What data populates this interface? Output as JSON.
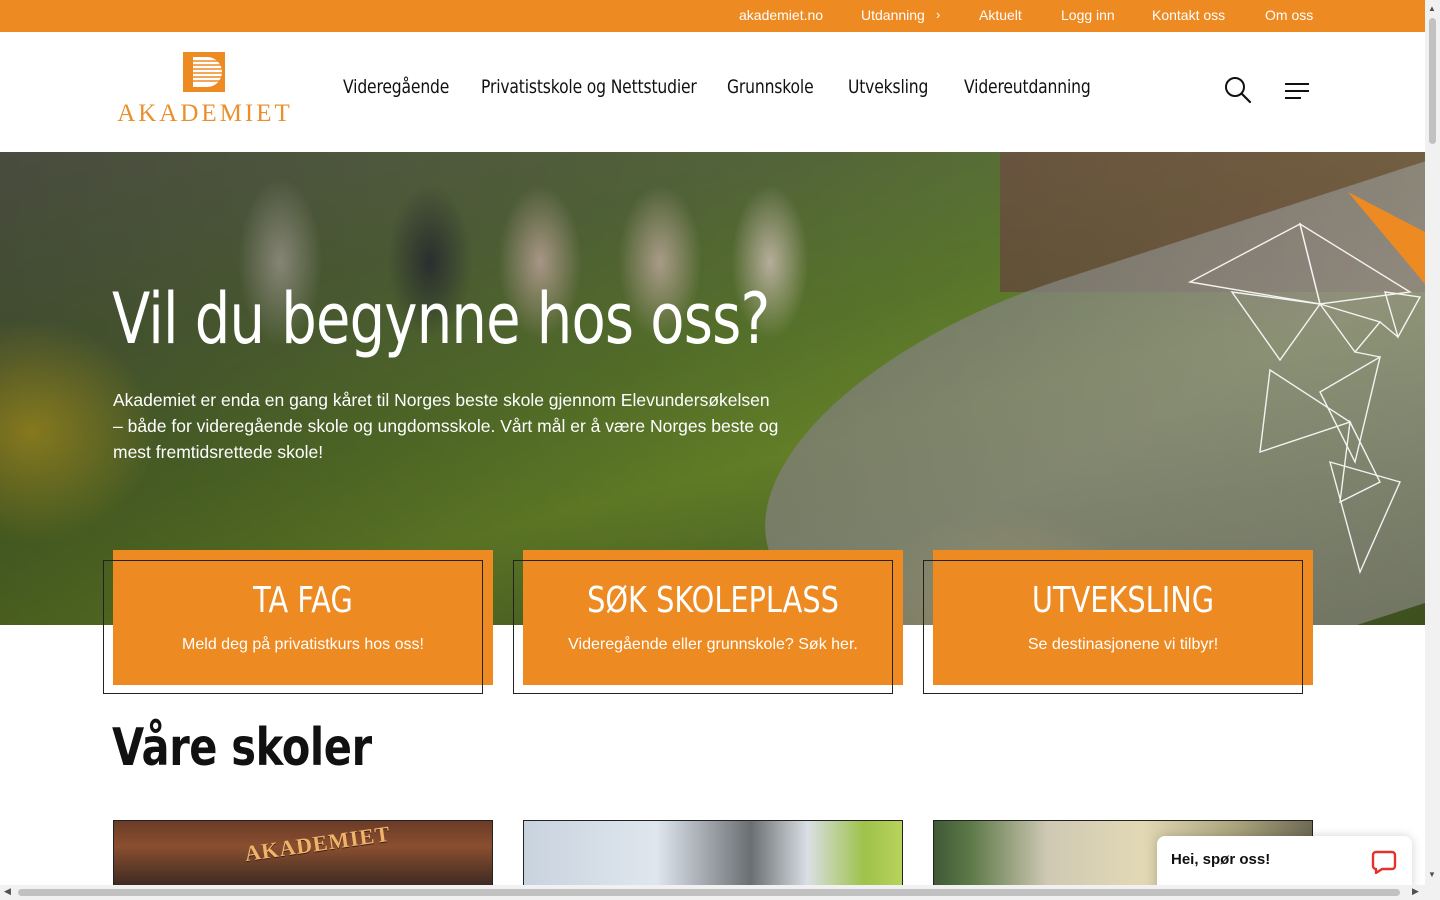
{
  "topbar": {
    "links": [
      "akademiet.no",
      "Utdanning",
      "Aktuelt",
      "Logg inn",
      "Kontakt oss",
      "Om oss"
    ]
  },
  "header": {
    "logo_text": "AKADEMIET",
    "nav": [
      "Videregående",
      "Privatistskole og Nettstudier",
      "Grunnskole",
      "Utveksling",
      "Videreutdanning"
    ],
    "search_icon": "search-icon",
    "menu_icon": "menu-icon"
  },
  "hero": {
    "title": "Vil du begynne hos oss?",
    "text": "Akademiet er enda en gang kåret til Norges beste skole gjennom Elevundersøkelsen – både for videregående skole og ungdomsskole. Vårt mål er å være Norges beste og mest fremtidsrettede skole!"
  },
  "cta": [
    {
      "title": "TA FAG",
      "subtitle": "Meld deg på privatistkurs hos oss!"
    },
    {
      "title": "SØK SKOLEPLASS",
      "subtitle": "Videregående eller grunnskole? Søk her."
    },
    {
      "title": "UTVEKSLING",
      "subtitle": "Se destinasjonene vi tilbyr!"
    }
  ],
  "schools": {
    "title": "Våre skoler",
    "sign_text": "AKADEMIET"
  },
  "chat": {
    "label": "Hei, spør oss!",
    "icon": "chat-bubble-icon"
  },
  "colors": {
    "brand_orange": "#ee8a22",
    "logo_orange": "#e98f2d"
  }
}
